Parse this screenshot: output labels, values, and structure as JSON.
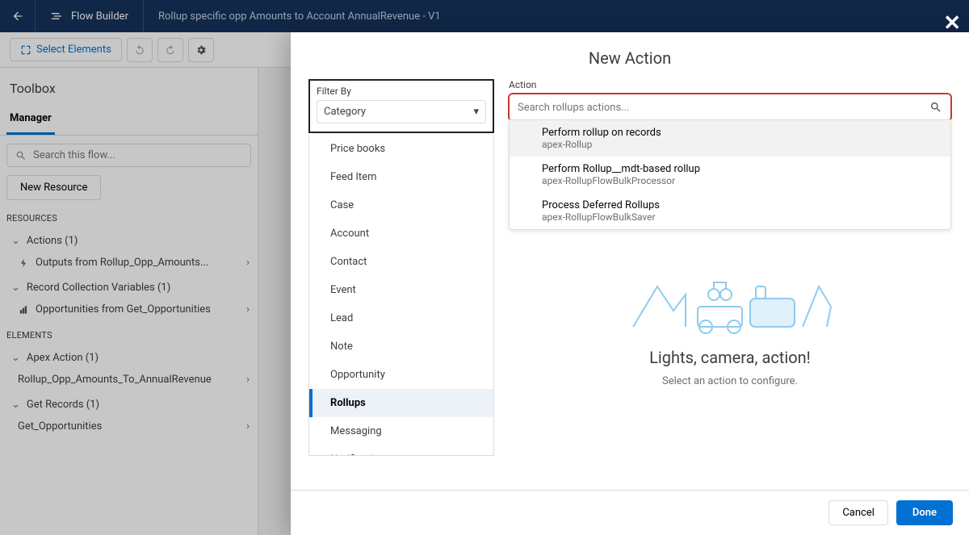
{
  "header": {
    "app_name": "Flow Builder",
    "flow_title": "Rollup specific opp Amounts to Account AnnualRevenue - V1"
  },
  "toolbar": {
    "select_elements": "Select Elements"
  },
  "sidebar": {
    "title": "Toolbox",
    "tab": "Manager",
    "search_placeholder": "Search this flow...",
    "new_resource": "New Resource",
    "resources_label": "RESOURCES",
    "elements_label": "ELEMENTS",
    "groups": {
      "actions": {
        "label": "Actions (1)",
        "item": "Outputs from Rollup_Opp_Amounts..."
      },
      "record_vars": {
        "label": "Record Collection Variables (1)",
        "item": "Opportunities from Get_Opportunities"
      },
      "apex": {
        "label": "Apex Action (1)",
        "item": "Rollup_Opp_Amounts_To_AnnualRevenue"
      },
      "get_records": {
        "label": "Get Records (1)",
        "item": "Get_Opportunities"
      }
    }
  },
  "modal": {
    "title": "New Action",
    "filter_by_label": "Filter By",
    "filter_value": "Category",
    "categories": [
      "Price books",
      "Feed Item",
      "Case",
      "Account",
      "Contact",
      "Event",
      "Lead",
      "Note",
      "Opportunity",
      "Rollups",
      "Messaging",
      "Notifications"
    ],
    "active_category": "Rollups",
    "action_label": "Action",
    "action_placeholder": "Search rollups actions...",
    "dropdown": [
      {
        "title": "Perform rollup on records",
        "sub": "apex-Rollup"
      },
      {
        "title": "Perform Rollup__mdt-based rollup",
        "sub": "apex-RollupFlowBulkProcessor"
      },
      {
        "title": "Process Deferred Rollups",
        "sub": "apex-RollupFlowBulkSaver"
      }
    ],
    "placeholder_title": "Lights, camera, action!",
    "placeholder_sub": "Select an action to configure.",
    "cancel": "Cancel",
    "done": "Done"
  }
}
